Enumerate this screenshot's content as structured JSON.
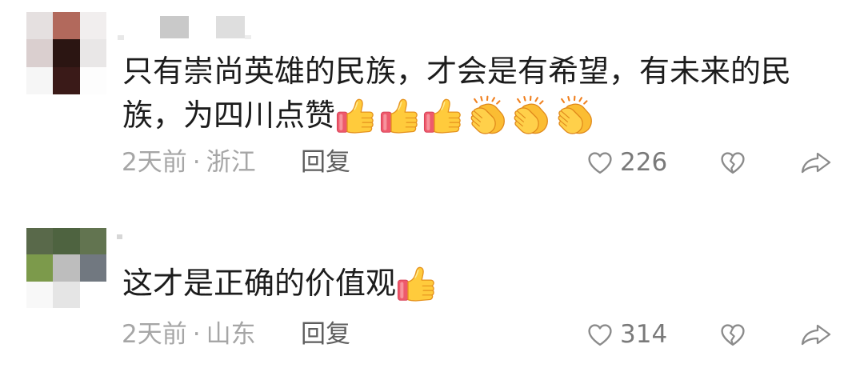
{
  "comments": [
    {
      "avatar_pixels": [
        "#e5e0e0",
        "#b2695c",
        "#f1eeee",
        "#dacfcf",
        "#2b1512",
        "#e9e7e7",
        "#f6f6f6",
        "#3a1a18",
        "#fdfdfd"
      ],
      "text_lines": [
        "只有崇尚英雄的民族，才会是有希望，有未来的民",
        "族，为四川点赞"
      ],
      "emojis": [
        "thumbs-up",
        "thumbs-up",
        "thumbs-up",
        "clapping-hands",
        "clapping-hands",
        "clapping-hands"
      ],
      "time": "2天前",
      "separator": "·",
      "location": "浙江",
      "reply_label": "回复",
      "like_icon": "heart-icon",
      "like_count": "226",
      "dislike_icon": "broken-heart-icon",
      "share_icon": "share-icon"
    },
    {
      "avatar_pixels": [
        "#59694a",
        "#4e6340",
        "#627450",
        "#7c9a4b",
        "#bdbdbd",
        "#717880",
        "#f8f8f8",
        "#e5e5e5",
        "#ffffff"
      ],
      "text_lines": [
        "这才是正确的价值观"
      ],
      "emojis": [
        "thumbs-up"
      ],
      "time": "2天前",
      "separator": "·",
      "location": "山东",
      "reply_label": "回复",
      "like_icon": "heart-icon",
      "like_count": "314",
      "dislike_icon": "broken-heart-icon",
      "share_icon": "share-icon"
    }
  ],
  "colors": {
    "text": "#1c1c1c",
    "meta": "#a6a6a6",
    "reply": "#5e5e5e",
    "count": "#7a7a7a",
    "icon": "#8b8b8b"
  }
}
